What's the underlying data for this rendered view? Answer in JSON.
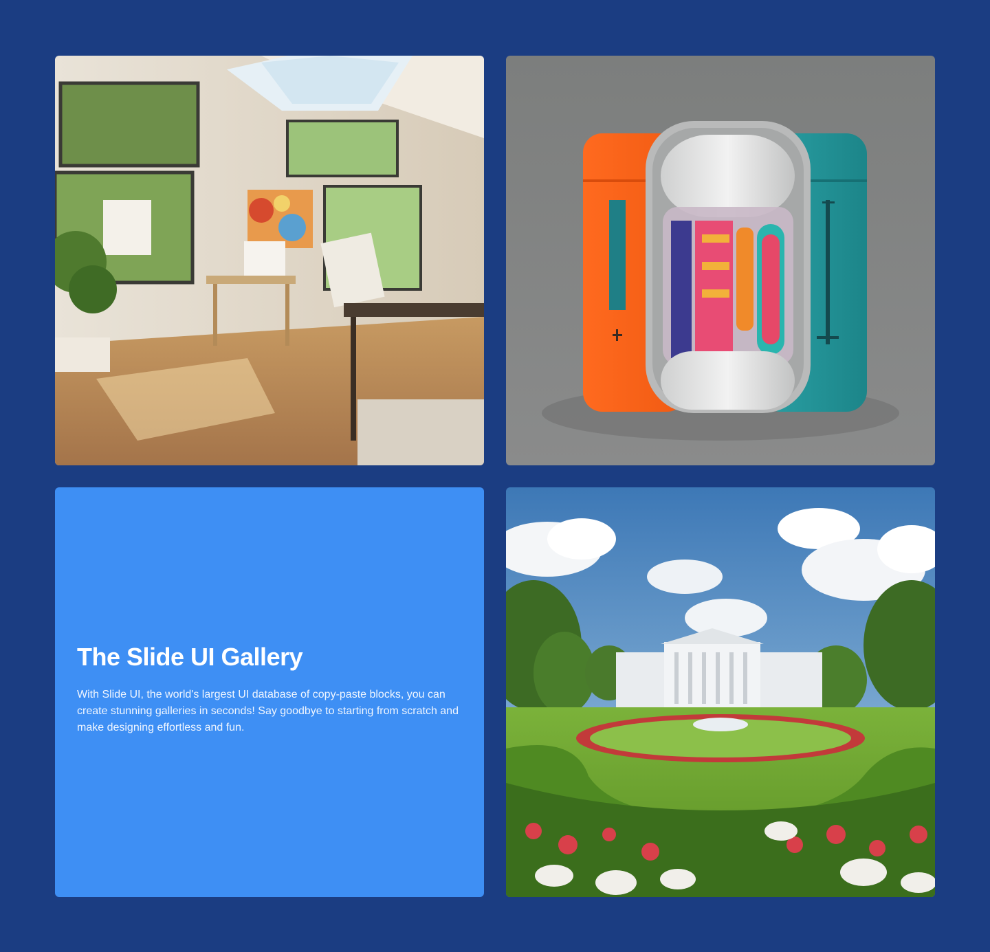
{
  "gallery": {
    "title": "The Slide UI Gallery",
    "description": "With Slide UI, the world's largest UI database of copy-paste blocks, you can create stunning galleries in seconds! Say goodbye to starting from scratch and make designing effortless and fun."
  },
  "images": [
    {
      "name": "art-studio-image"
    },
    {
      "name": "capsule-product-image"
    },
    {
      "name": "white-house-garden-image"
    }
  ],
  "colors": {
    "page_background": "#1b3d82",
    "text_tile_background": "#3e8ff4",
    "text": "#ffffff"
  }
}
